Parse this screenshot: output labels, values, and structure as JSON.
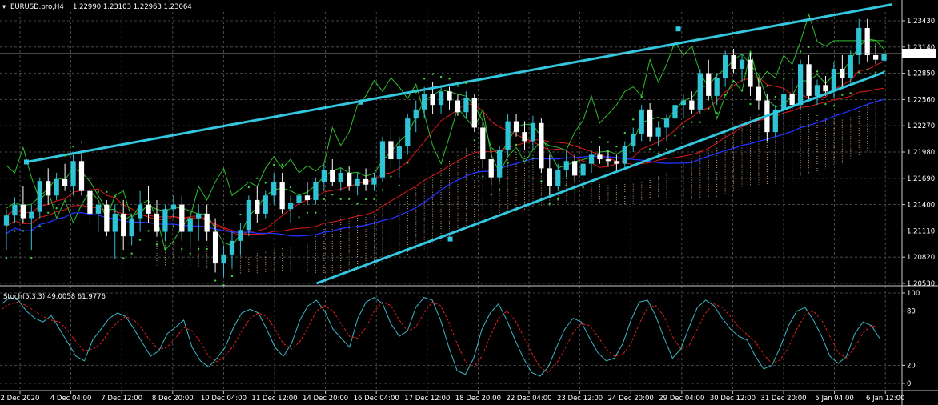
{
  "header": {
    "symbol_label": "EURUSD.pro,H4",
    "ohlc_label": "1.22990 1.23103 1.22963 1.23064"
  },
  "current_price_label": "1.23064",
  "colors": {
    "background": "#000000",
    "grid": "#5a5a5a",
    "bull_candle": "#2ec4d6",
    "bear_candle": "#ffffff",
    "channel": "#33c8e0",
    "cloud_dots": "#f4c49a",
    "psar": "#3cd23c",
    "green_line": "#2fbe2f",
    "ma_red": "#e01818",
    "ma_blue": "#2233ff",
    "stoch_main": "#3cb8c8",
    "stoch_signal": "#e02020"
  },
  "chart_data": [
    {
      "type": "candlestick",
      "name": "price",
      "y_ticks": [
        "1.23430",
        "1.23140",
        "1.22850",
        "1.22560",
        "1.22270",
        "1.21980",
        "1.21690",
        "1.21400",
        "1.21110",
        "1.20820",
        "1.20530"
      ],
      "ylim": [
        1.2053,
        1.2357
      ],
      "x_tick_labels": [
        "2 Dec 2020",
        "4 Dec 04:00",
        "7 Dec 12:00",
        "8 Dec 20:00",
        "10 Dec 04:00",
        "11 Dec 12:00",
        "14 Dec 20:00",
        "16 Dec 04:00",
        "17 Dec 12:00",
        "18 Dec 20:00",
        "22 Dec 04:00",
        "23 Dec 12:00",
        "24 Dec 20:00",
        "29 Dec 04:00",
        "30 Dec 12:00",
        "31 Dec 20:00",
        "5 Jan 04:00",
        "6 Jan 12:00"
      ],
      "candles": [
        [
          1.2117,
          1.2135,
          1.209,
          1.2128
        ],
        [
          1.2128,
          1.2148,
          1.212,
          1.214
        ],
        [
          1.214,
          1.216,
          1.212,
          1.2125
        ],
        [
          1.2125,
          1.214,
          1.209,
          1.2132
        ],
        [
          1.2132,
          1.217,
          1.2125,
          1.2166
        ],
        [
          1.2166,
          1.218,
          1.214,
          1.215
        ],
        [
          1.215,
          1.2175,
          1.2145,
          1.2168
        ],
        [
          1.2168,
          1.2185,
          1.2155,
          1.216
        ],
        [
          1.216,
          1.2195,
          1.215,
          1.2188
        ],
        [
          1.2188,
          1.22,
          1.215,
          1.2155
        ],
        [
          1.2155,
          1.216,
          1.212,
          1.213
        ],
        [
          1.213,
          1.2145,
          1.211,
          1.214
        ],
        [
          1.214,
          1.2145,
          1.2105,
          1.211
        ],
        [
          1.211,
          1.214,
          1.208,
          1.213
        ],
        [
          1.213,
          1.2145,
          1.209,
          1.2105
        ],
        [
          1.2105,
          1.213,
          1.2095,
          1.2125
        ],
        [
          1.2125,
          1.2155,
          1.211,
          1.214
        ],
        [
          1.214,
          1.216,
          1.212,
          1.213
        ],
        [
          1.213,
          1.2145,
          1.2105,
          1.211
        ],
        [
          1.211,
          1.214,
          1.21,
          1.2135
        ],
        [
          1.2135,
          1.215,
          1.2125,
          1.214
        ],
        [
          1.214,
          1.215,
          1.21,
          1.211
        ],
        [
          1.211,
          1.2135,
          1.2095,
          1.2125
        ],
        [
          1.2125,
          1.214,
          1.21,
          1.213
        ],
        [
          1.213,
          1.214,
          1.21,
          1.211
        ],
        [
          1.211,
          1.2125,
          1.2065,
          1.2075
        ],
        [
          1.2075,
          1.2095,
          1.206,
          1.2085
        ],
        [
          1.2085,
          1.211,
          1.207,
          1.21
        ],
        [
          1.21,
          1.212,
          1.2085,
          1.2112
        ],
        [
          1.2112,
          1.215,
          1.2105,
          1.2145
        ],
        [
          1.2145,
          1.216,
          1.212,
          1.213
        ],
        [
          1.213,
          1.2155,
          1.2125,
          1.215
        ],
        [
          1.215,
          1.2175,
          1.214,
          1.2165
        ],
        [
          1.2165,
          1.2175,
          1.213,
          1.2135
        ],
        [
          1.2135,
          1.215,
          1.212,
          1.2142
        ],
        [
          1.2142,
          1.216,
          1.2135,
          1.215
        ],
        [
          1.215,
          1.2165,
          1.214,
          1.2145
        ],
        [
          1.2145,
          1.217,
          1.214,
          1.2165
        ],
        [
          1.2165,
          1.2185,
          1.2155,
          1.2178
        ],
        [
          1.2178,
          1.219,
          1.216,
          1.2165
        ],
        [
          1.2165,
          1.218,
          1.2155,
          1.2175
        ],
        [
          1.2175,
          1.2182,
          1.2155,
          1.216
        ],
        [
          1.216,
          1.2175,
          1.215,
          1.2168
        ],
        [
          1.2168,
          1.218,
          1.2155,
          1.2162
        ],
        [
          1.2162,
          1.2175,
          1.2155,
          1.217
        ],
        [
          1.217,
          1.2215,
          1.2165,
          1.221
        ],
        [
          1.221,
          1.2225,
          1.218,
          1.219
        ],
        [
          1.219,
          1.2215,
          1.217,
          1.2205
        ],
        [
          1.2205,
          1.224,
          1.2195,
          1.2235
        ],
        [
          1.2235,
          1.2255,
          1.222,
          1.2245
        ],
        [
          1.2245,
          1.227,
          1.2235,
          1.2262
        ],
        [
          1.2262,
          1.2275,
          1.224,
          1.225
        ],
        [
          1.225,
          1.2272,
          1.224,
          1.2265
        ],
        [
          1.2265,
          1.227,
          1.2245,
          1.2255
        ],
        [
          1.2255,
          1.2262,
          1.2238,
          1.2242
        ],
        [
          1.2242,
          1.2265,
          1.2235,
          1.2258
        ],
        [
          1.2258,
          1.2262,
          1.222,
          1.2225
        ],
        [
          1.2225,
          1.2232,
          1.218,
          1.219
        ],
        [
          1.219,
          1.22,
          1.216,
          1.217
        ],
        [
          1.217,
          1.2205,
          1.2165,
          1.22
        ],
        [
          1.22,
          1.224,
          1.2195,
          1.2232
        ],
        [
          1.2232,
          1.224,
          1.2215,
          1.222
        ],
        [
          1.222,
          1.2232,
          1.22,
          1.221
        ],
        [
          1.221,
          1.2238,
          1.22,
          1.223
        ],
        [
          1.223,
          1.2235,
          1.2175,
          1.218
        ],
        [
          1.218,
          1.2195,
          1.215,
          1.216
        ],
        [
          1.216,
          1.2185,
          1.2155,
          1.2178
        ],
        [
          1.2178,
          1.22,
          1.217,
          1.2188
        ],
        [
          1.2188,
          1.2196,
          1.2165,
          1.2172
        ],
        [
          1.2172,
          1.219,
          1.2168,
          1.2185
        ],
        [
          1.2185,
          1.22,
          1.2175,
          1.2195
        ],
        [
          1.2195,
          1.2205,
          1.2185,
          1.219
        ],
        [
          1.219,
          1.22,
          1.2182,
          1.2188
        ],
        [
          1.2188,
          1.2195,
          1.2176,
          1.2185
        ],
        [
          1.2185,
          1.221,
          1.218,
          1.2205
        ],
        [
          1.2205,
          1.2225,
          1.2198,
          1.2218
        ],
        [
          1.2218,
          1.225,
          1.221,
          1.2245
        ],
        [
          1.2245,
          1.2252,
          1.221,
          1.2215
        ],
        [
          1.2215,
          1.2232,
          1.2205,
          1.2225
        ],
        [
          1.2225,
          1.224,
          1.221,
          1.2235
        ],
        [
          1.2235,
          1.2258,
          1.2225,
          1.225
        ],
        [
          1.225,
          1.2262,
          1.2235,
          1.2255
        ],
        [
          1.2255,
          1.2265,
          1.224,
          1.2245
        ],
        [
          1.2245,
          1.229,
          1.224,
          1.2285
        ],
        [
          1.2285,
          1.23,
          1.2255,
          1.226
        ],
        [
          1.226,
          1.2285,
          1.225,
          1.228
        ],
        [
          1.228,
          1.231,
          1.227,
          1.2305
        ],
        [
          1.2305,
          1.2312,
          1.2285,
          1.229
        ],
        [
          1.229,
          1.2306,
          1.2275,
          1.23
        ],
        [
          1.23,
          1.2308,
          1.226,
          1.227
        ],
        [
          1.227,
          1.228,
          1.2245,
          1.2255
        ],
        [
          1.2255,
          1.2262,
          1.221,
          1.222
        ],
        [
          1.222,
          1.225,
          1.2215,
          1.2245
        ],
        [
          1.2245,
          1.227,
          1.2235,
          1.2262
        ],
        [
          1.2262,
          1.228,
          1.2245,
          1.225
        ],
        [
          1.225,
          1.23,
          1.2245,
          1.2295
        ],
        [
          1.2295,
          1.2305,
          1.2255,
          1.226
        ],
        [
          1.226,
          1.2278,
          1.225,
          1.2272
        ],
        [
          1.2272,
          1.2282,
          1.226,
          1.2265
        ],
        [
          1.2265,
          1.2298,
          1.2258,
          1.229
        ],
        [
          1.229,
          1.2305,
          1.227,
          1.228
        ],
        [
          1.228,
          1.231,
          1.2272,
          1.2305
        ],
        [
          1.2305,
          1.2345,
          1.2295,
          1.2335
        ],
        [
          1.2335,
          1.2345,
          1.2298,
          1.2305
        ],
        [
          1.2305,
          1.2318,
          1.2295,
          1.23
        ],
        [
          1.2299,
          1.231,
          1.2296,
          1.2306
        ]
      ],
      "channel": {
        "upper": [
          [
            0,
            1.2187
          ],
          [
            104,
            1.2361
          ]
        ],
        "lower": [
          [
            28,
            1.2053
          ],
          [
            104,
            1.2286
          ]
        ],
        "anchor_points": [
          [
            0,
            1.2187
          ],
          [
            40,
            1.2253
          ],
          [
            78,
            1.2334
          ],
          [
            44,
            1.2102
          ]
        ]
      }
    },
    {
      "type": "line",
      "name": "stochastic",
      "indicator_label": "Stoch(5,3,3) 49.0058 61.9776",
      "y_ticks": [
        "100",
        "80",
        "20",
        "0"
      ],
      "ylim": [
        0,
        100
      ],
      "series": [
        {
          "name": "main",
          "values": [
            88,
            95,
            92,
            80,
            72,
            68,
            75,
            60,
            45,
            30,
            25,
            48,
            60,
            72,
            78,
            74,
            60,
            45,
            30,
            36,
            55,
            62,
            70,
            40,
            25,
            18,
            28,
            40,
            62,
            78,
            82,
            78,
            60,
            40,
            30,
            44,
            70,
            86,
            92,
            80,
            60,
            50,
            40,
            72,
            90,
            95,
            88,
            66,
            52,
            58,
            84,
            95,
            92,
            70,
            40,
            14,
            10,
            28,
            60,
            78,
            88,
            70,
            48,
            28,
            12,
            8,
            18,
            40,
            60,
            72,
            68,
            50,
            34,
            25,
            28,
            44,
            70,
            90,
            92,
            74,
            50,
            28,
            38,
            62,
            84,
            92,
            86,
            72,
            60,
            52,
            48,
            30,
            16,
            20,
            40,
            64,
            80,
            84,
            70,
            52,
            30,
            22,
            30,
            55,
            68,
            64,
            50
          ]
        },
        {
          "name": "signal",
          "values": [
            82,
            88,
            90,
            86,
            80,
            74,
            70,
            68,
            58,
            46,
            36,
            38,
            44,
            58,
            68,
            74,
            70,
            60,
            46,
            38,
            40,
            50,
            62,
            58,
            46,
            30,
            24,
            30,
            42,
            58,
            72,
            78,
            74,
            60,
            44,
            38,
            46,
            62,
            80,
            86,
            80,
            66,
            52,
            50,
            62,
            80,
            90,
            86,
            70,
            58,
            62,
            78,
            90,
            86,
            68,
            44,
            24,
            18,
            30,
            52,
            72,
            80,
            70,
            52,
            34,
            18,
            12,
            22,
            38,
            56,
            66,
            64,
            52,
            38,
            30,
            32,
            44,
            66,
            84,
            86,
            74,
            52,
            38,
            42,
            60,
            78,
            88,
            84,
            74,
            62,
            54,
            46,
            32,
            22,
            26,
            40,
            60,
            76,
            80,
            70,
            52,
            34,
            28,
            40,
            56,
            64,
            62
          ]
        }
      ]
    }
  ]
}
